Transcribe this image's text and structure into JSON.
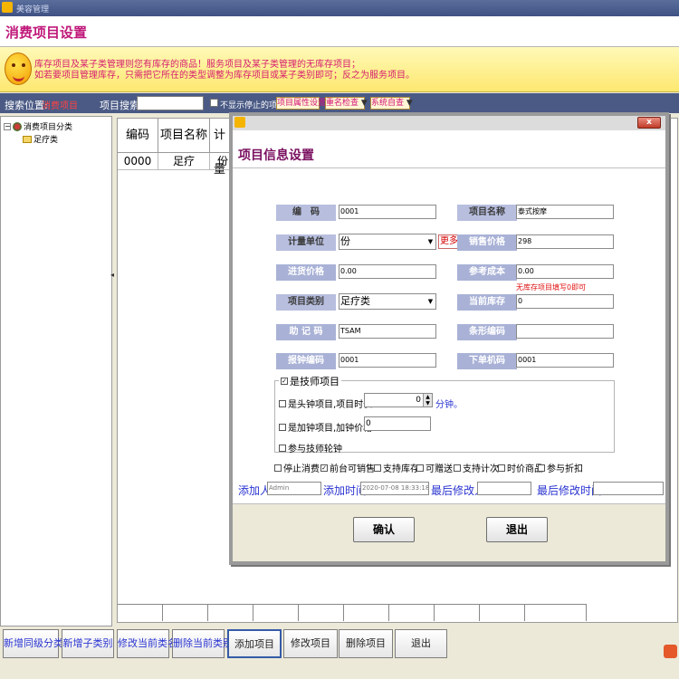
{
  "window": {
    "title": "美容管理"
  },
  "header": {
    "title": "消费项目设置"
  },
  "notice": {
    "line1": "库存项目及某子类管理则您有库存的商品！服务项目及某子类管理的无库存项目；",
    "line2": "如若要项目管理库存，只需把它所在的类型调整为库存项目或某子类别即可；反之为服务项目。"
  },
  "searchbar": {
    "location_label": "搜索位置:",
    "location_value": "消费项目",
    "search_label": "项目搜索:",
    "search_value": "",
    "hide_stopped_label": "不显示停止的项目",
    "attr_setting": "项目属性设置",
    "duplicate_check": "重名检查",
    "auto_check": "系统自查"
  },
  "tree": {
    "root": "消费项目分类",
    "children": [
      "足疗类"
    ]
  },
  "grid": {
    "headers": [
      "编码",
      "项目名称",
      "计量"
    ],
    "rows": [
      [
        "0000",
        "足疗",
        "份"
      ]
    ]
  },
  "bottom_buttons": [
    "新增同级分类",
    "新增子类别",
    "修改当前类名",
    "删除当前类别",
    "添加项目",
    "修改项目",
    "删除项目",
    "退出"
  ],
  "dialog": {
    "close": "x",
    "title": "项目信息设置",
    "labels": {
      "code": "编　码",
      "name": "项目名称",
      "unit": "计量单位",
      "sale_price": "销售价格",
      "purchase_price": "进货价格",
      "ref_cost": "参考成本",
      "category": "项目类别",
      "stock": "当前库存",
      "mnemonic": "助 记 码",
      "barcode": "条形编码",
      "clock_code": "报钟编码",
      "order_code": "下单机码"
    },
    "values": {
      "code": "0001",
      "name": "泰式按摩",
      "unit": "份",
      "sale_price": "298",
      "purchase_price": "0.00",
      "ref_cost": "0.00",
      "category": "足疗类",
      "stock": "0",
      "mnemonic": "TSAM",
      "barcode": "",
      "clock_code": "0001",
      "order_code": "0001"
    },
    "more": "更多",
    "hint": "无库存项目填写0即可",
    "technician_group": {
      "legend": "是技师项目",
      "checked": true,
      "head_clock": "是头钟项目,项目时长",
      "duration_value": "0",
      "minutes_unit": "分钟。",
      "add_clock": "是加钟项目,加钟价格",
      "add_price_value": "0",
      "rotation": "参与技师轮钟"
    },
    "options": [
      {
        "label": "停止消费",
        "checked": false
      },
      {
        "label": "前台可销售",
        "checked": true
      },
      {
        "label": "支持库存",
        "checked": false
      },
      {
        "label": "可赠送",
        "checked": false
      },
      {
        "label": "支持计次",
        "checked": false
      },
      {
        "label": "时价商品",
        "checked": false
      },
      {
        "label": "参与折扣",
        "checked": false
      }
    ],
    "meta": {
      "added_by_label": "添加人",
      "added_by_value": "Admin",
      "added_time_label": "添加时间",
      "added_time_value": "2020-07-08 18:33:18",
      "modified_by_label": "最后修改人",
      "modified_by_value": "",
      "modified_time_label": "最后修改时间",
      "modified_time_value": ""
    },
    "confirm": "确认",
    "exit": "退出"
  },
  "colors": {
    "title": "#c0187a",
    "notice_text": "#d51c6f",
    "search_bar": "#4a5a85",
    "accent_blue": "#2a34d1",
    "label_bg": "#b7bede"
  }
}
